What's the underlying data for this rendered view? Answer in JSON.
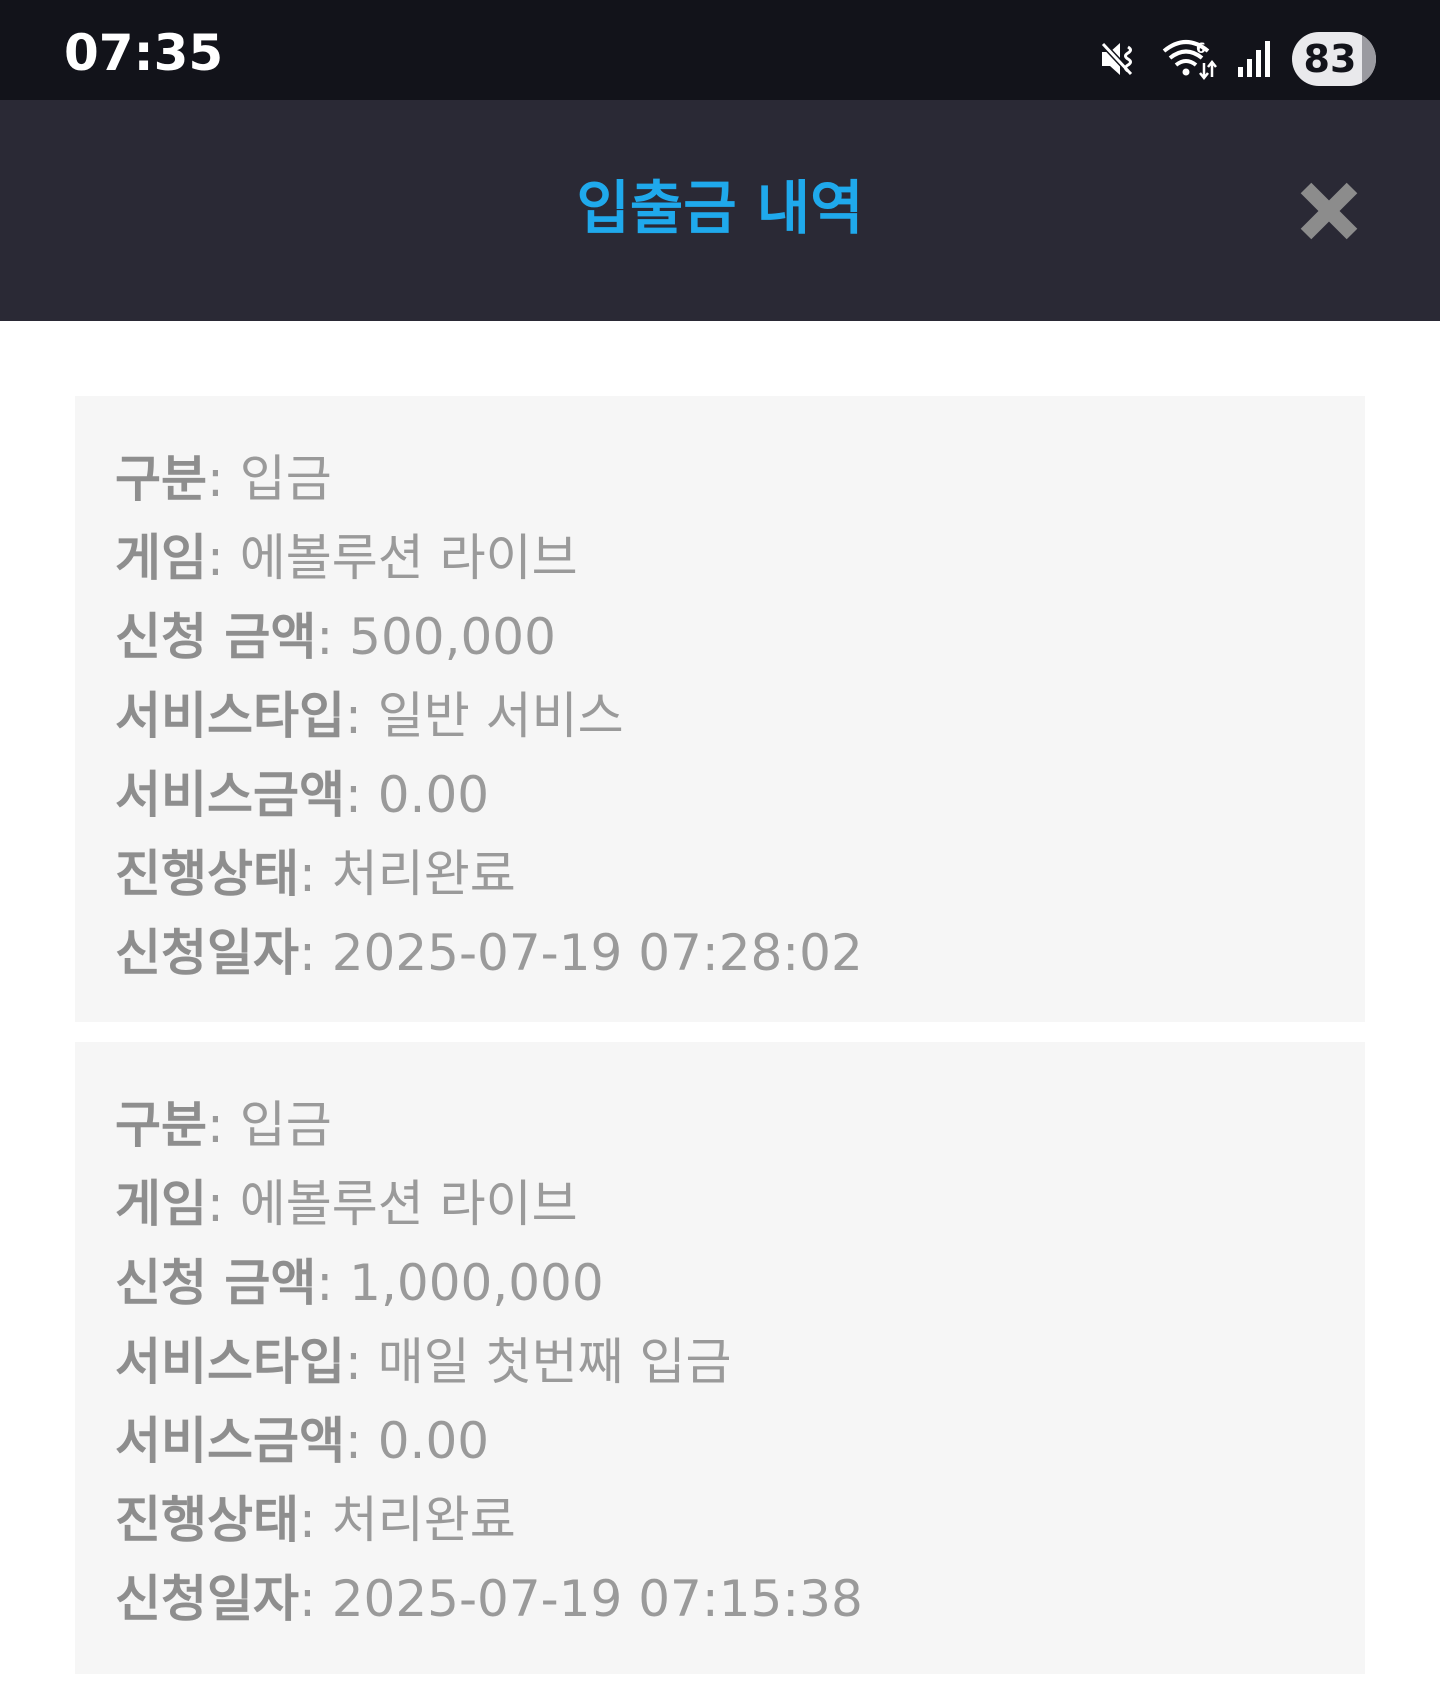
{
  "status_bar": {
    "time": "07:35",
    "battery": "83",
    "icons": [
      "mute-icon",
      "wifi-icon",
      "signal-icon",
      "battery-icon"
    ]
  },
  "header": {
    "title": "입출금 내역",
    "close_icon": "close-icon",
    "title_color": "#1fa9ec"
  },
  "labels": {
    "type": "구분",
    "game": "게임",
    "amount": "신청 금액",
    "service_type": "서비스타입",
    "service_amount": "서비스금액",
    "status": "진행상태",
    "date": "신청일자",
    "separator": ": "
  },
  "records": [
    {
      "type": "입금",
      "game": "에볼루션 라이브",
      "amount": "500,000",
      "service_type": "일반 서비스",
      "service_amount": "0.00",
      "status": "처리완료",
      "date": "2025-07-19 07:28:02"
    },
    {
      "type": "입금",
      "game": "에볼루션 라이브",
      "amount": "1,000,000",
      "service_type": "매일 첫번째 입금",
      "service_amount": "0.00",
      "status": "처리완료",
      "date": "2025-07-19 07:15:38"
    }
  ]
}
